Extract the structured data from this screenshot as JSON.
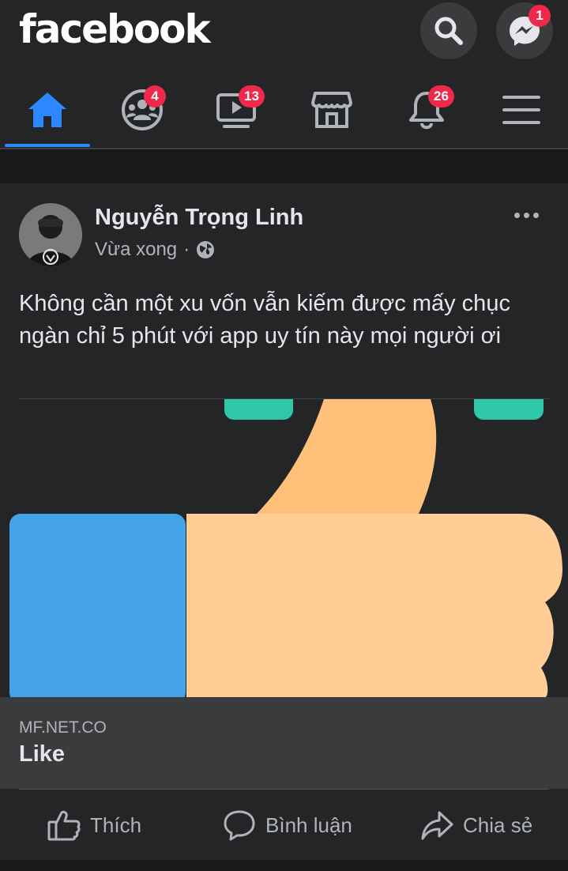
{
  "header": {
    "logo": "facebook",
    "search_icon": "search-icon",
    "messenger_icon": "messenger-icon",
    "messenger_badge": "1"
  },
  "nav": {
    "items": [
      {
        "icon": "home-icon",
        "active": true,
        "badge": ""
      },
      {
        "icon": "groups-icon",
        "active": false,
        "badge": "4"
      },
      {
        "icon": "watch-icon",
        "active": false,
        "badge": "13"
      },
      {
        "icon": "marketplace-icon",
        "active": false,
        "badge": ""
      },
      {
        "icon": "bell-icon",
        "active": false,
        "badge": "26"
      },
      {
        "icon": "menu-icon",
        "active": false,
        "badge": ""
      }
    ]
  },
  "post": {
    "author": "Nguyễn Trọng Linh",
    "timestamp": "Vừa xong",
    "separator": "·",
    "privacy_icon": "globe-icon",
    "text": "Không cần một xu vốn vẫn kiếm được mấy chục ngàn chỉ 5 phút với app uy tín này mọi người ơi",
    "link": {
      "domain": "MF.NET.CO",
      "title": "Like"
    },
    "actions": {
      "like": "Thích",
      "comment": "Bình luận",
      "share": "Chia sẻ"
    }
  },
  "colors": {
    "background": "#18191a",
    "surface": "#242526",
    "accent": "#2d88ff",
    "badge": "#f02849",
    "thumb_skin": "#ffcd95",
    "thumb_sleeve": "#45a3ea",
    "thumb_cuff": "#2ec8a8"
  }
}
